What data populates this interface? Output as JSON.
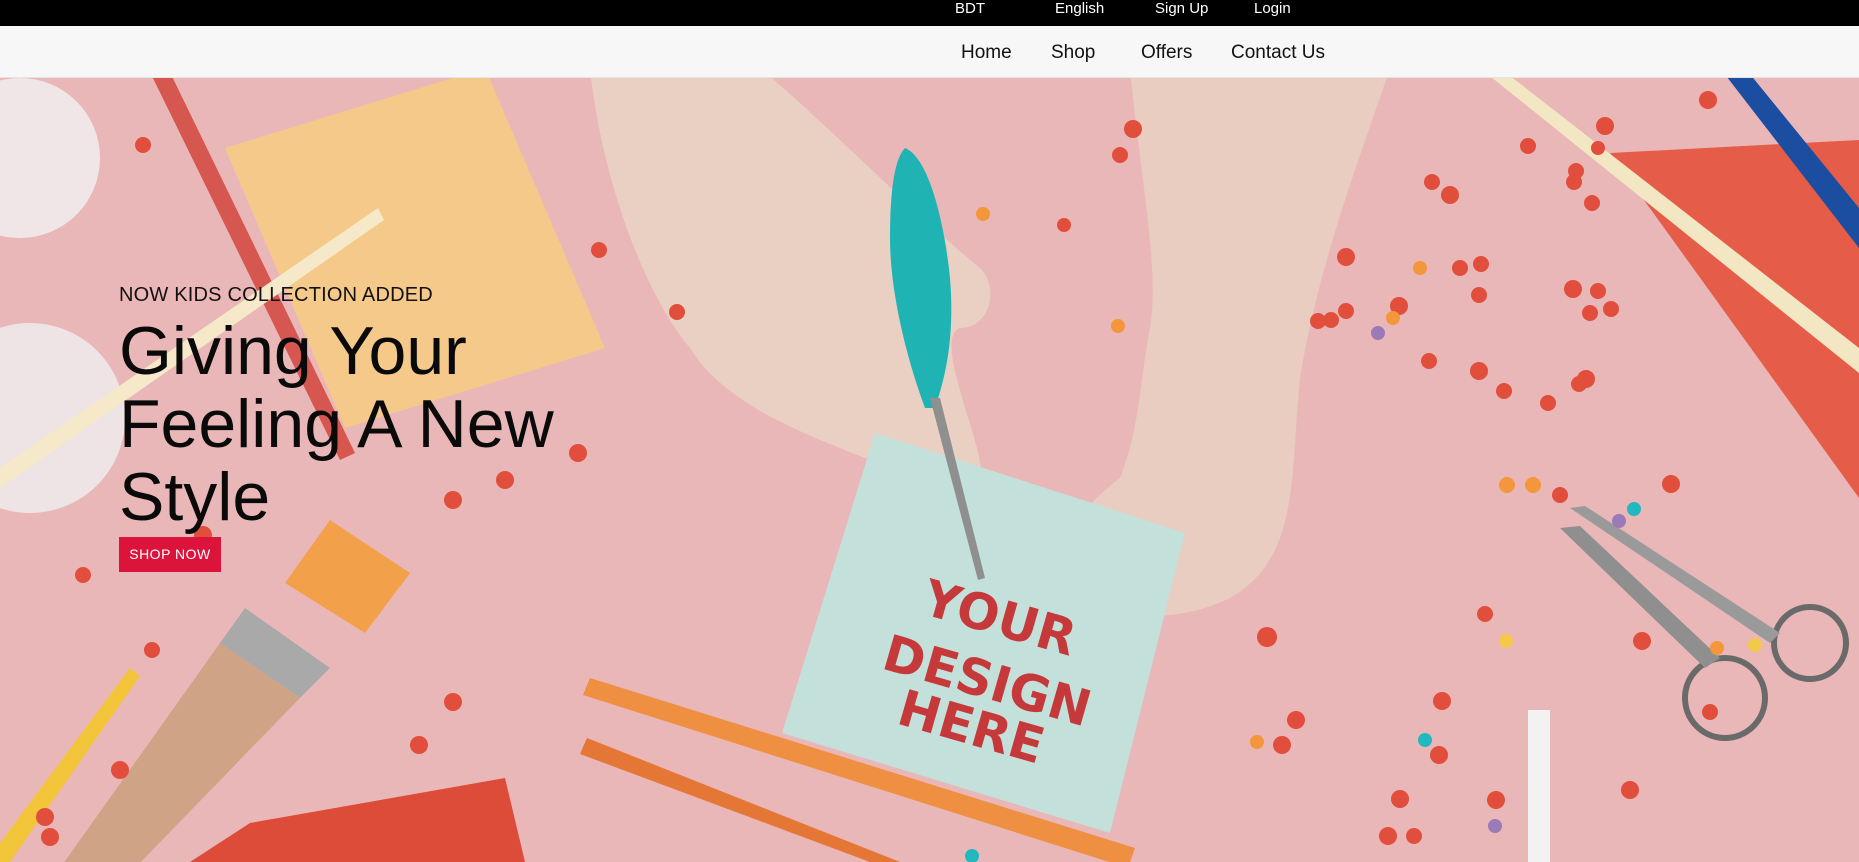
{
  "topbar": {
    "currency": "BDT",
    "language": "English",
    "signup": "Sign Up",
    "login": "Login"
  },
  "nav": {
    "items": [
      {
        "label": "Home"
      },
      {
        "label": "Shop"
      },
      {
        "label": "Offers"
      },
      {
        "label": "Contact Us"
      }
    ]
  },
  "hero": {
    "eyebrow": "NOW KIDS COLLECTION ADDED",
    "headline": "Giving Your Feeling A New Style",
    "cta_label": "SHOP NOW",
    "image_note_text": [
      "YOUR",
      "DESIGN",
      "HERE"
    ]
  },
  "colors": {
    "topbar_bg": "#000000",
    "nav_bg": "#f7f7f7",
    "hero_bg": "#eab7b8",
    "cta": "#dc143c",
    "note_text": "#c6393b"
  }
}
